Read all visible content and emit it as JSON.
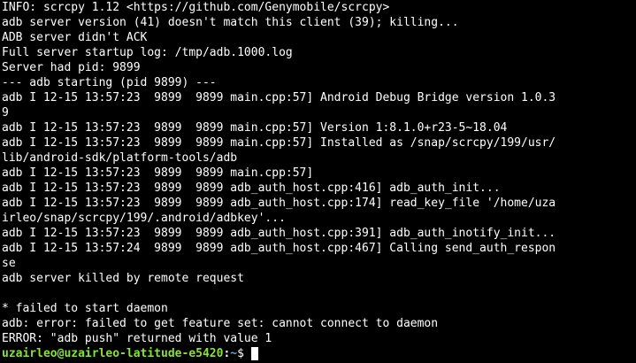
{
  "terminal": {
    "background": "#000000",
    "foreground": "#ffffff",
    "lines": [
      "INFO: scrcpy 1.12 <https://github.com/Genymobile/scrcpy>",
      "adb server version (41) doesn't match this client (39); killing...",
      "ADB server didn't ACK",
      "Full server startup log: /tmp/adb.1000.log",
      "Server had pid: 9899",
      "--- adb starting (pid 9899) ---",
      "adb I 12-15 13:57:23  9899  9899 main.cpp:57] Android Debug Bridge version 1.0.3",
      "9",
      "adb I 12-15 13:57:23  9899  9899 main.cpp:57] Version 1:8.1.0+r23-5~18.04",
      "adb I 12-15 13:57:23  9899  9899 main.cpp:57] Installed as /snap/scrcpy/199/usr/",
      "lib/android-sdk/platform-tools/adb",
      "adb I 12-15 13:57:23  9899  9899 main.cpp:57]",
      "adb I 12-15 13:57:23  9899  9899 adb_auth_host.cpp:416] adb_auth_init...",
      "adb I 12-15 13:57:23  9899  9899 adb_auth_host.cpp:174] read_key_file '/home/uza",
      "irleo/snap/scrcpy/199/.android/adbkey'...",
      "adb I 12-15 13:57:23  9899  9899 adb_auth_host.cpp:391] adb_auth_inotify_init...",
      "adb I 12-15 13:57:24  9899  9899 adb_auth_host.cpp:467] Calling send_auth_respon",
      "se",
      "adb server killed by remote request",
      "",
      "* failed to start daemon",
      "adb: error: failed to get feature set: cannot connect to daemon",
      "ERROR: \"adb push\" returned with value 1"
    ],
    "prompt": {
      "user_host": "uzairleo@uzairleo-latitude-e5420",
      "separator": ":",
      "path": "~",
      "symbol": "$ ",
      "user_color": "#8ae234",
      "path_color": "#729fcf"
    }
  }
}
